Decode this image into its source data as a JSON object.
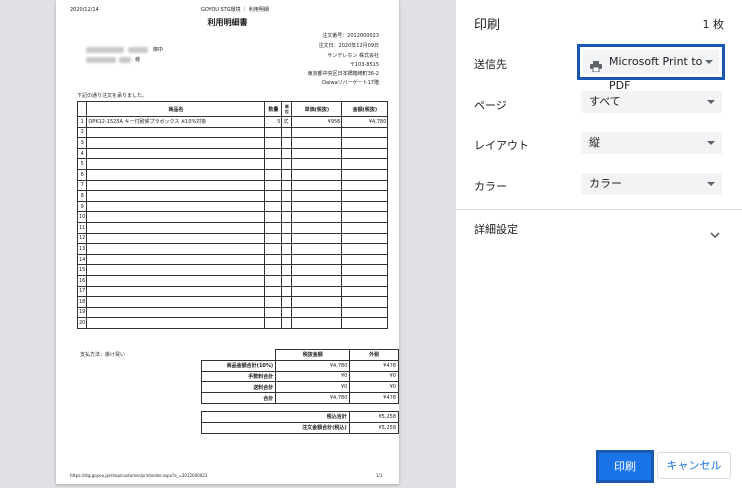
{
  "document": {
    "date": "2020/12/14",
    "header_center": "GOYOU STG環境 ｜ 利用明細",
    "title": "利用明細書",
    "recipient_suffix": "御中",
    "recipient_suffix2": "様",
    "order_number": "注文番号：2012000023",
    "order_date": "注文日：2020年12月09日",
    "company": "サンデレホン 株式会社",
    "postal": "〒103-8515",
    "address1": "東京都中央区日本橋箱崎町36-2",
    "address2": "Daiwaリバーゲート17階",
    "intro": "下記の通り注文を承りました。",
    "columns": {
      "no": "",
      "name": "商品名",
      "qty": "数量",
      "unit": "単位",
      "price": "単価(税抜)",
      "amount": "金額(税抜)"
    },
    "rows": [
      {
        "no": "1",
        "name": "OPK12-1525A キー付耐候プラボックス ※10%対象",
        "qty": "5",
        "unit": "式",
        "price": "¥956",
        "amount": "¥4,780"
      },
      {
        "no": "2"
      },
      {
        "no": "3"
      },
      {
        "no": "4"
      },
      {
        "no": "5"
      },
      {
        "no": "6"
      },
      {
        "no": "7"
      },
      {
        "no": "8"
      },
      {
        "no": "9"
      },
      {
        "no": "10"
      },
      {
        "no": "11"
      },
      {
        "no": "12"
      },
      {
        "no": "13"
      },
      {
        "no": "14"
      },
      {
        "no": "15"
      },
      {
        "no": "16"
      },
      {
        "no": "17"
      },
      {
        "no": "18"
      },
      {
        "no": "19"
      },
      {
        "no": "20"
      }
    ],
    "payment": "支払方法：掛け買い",
    "summary_headers": {
      "excl": "税抜金額",
      "tax": "外税"
    },
    "summary": [
      {
        "label": "商品金額合計(10%)",
        "excl": "¥4,780",
        "tax": "¥478"
      },
      {
        "label": "手数料合計",
        "excl": "¥0",
        "tax": "¥0"
      },
      {
        "label": "送料合計",
        "excl": "¥0",
        "tax": "¥0"
      },
      {
        "label": "合計",
        "excl": "¥4,780",
        "tax": "¥478"
      }
    ],
    "totals": [
      {
        "label": "税込合計",
        "value": "¥5,258"
      },
      {
        "label": "注文金額合計(税込)",
        "value": "¥5,258"
      }
    ],
    "footer_url": "https://stg.goyou.jp/shop/customer/printorder.aspx?o_=2012000023",
    "page": "1/1"
  },
  "panel": {
    "title": "印刷",
    "sheet_count": "1 枚",
    "destination_label": "送信先",
    "destination_value": "Microsoft Print to PDF",
    "pages_label": "ページ",
    "pages_value": "すべて",
    "layout_label": "レイアウト",
    "layout_value": "縦",
    "color_label": "カラー",
    "color_value": "カラー",
    "more_settings_label": "詳細設定",
    "print_button": "印刷",
    "cancel_button": "キャンセル"
  }
}
